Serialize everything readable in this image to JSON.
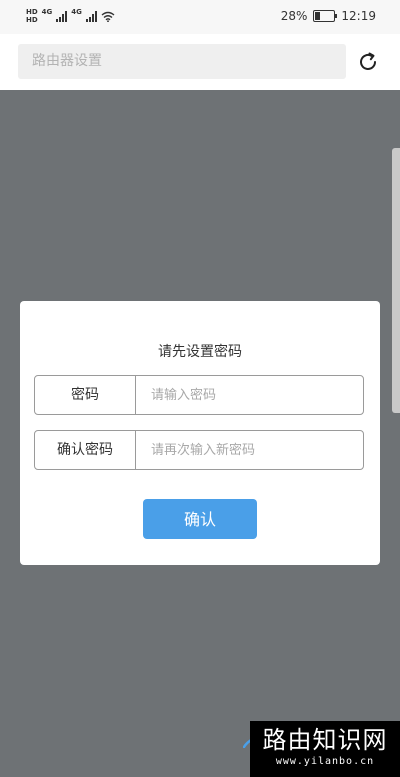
{
  "status_bar": {
    "left_labels": [
      "HD",
      "4G",
      "4G",
      "HD"
    ],
    "battery": "28%",
    "battery_level": 0.28,
    "time": "12:19",
    "icons": [
      "hd-icon",
      "signal-icon",
      "wifi-icon",
      "battery-icon"
    ]
  },
  "topbar": {
    "address_placeholder": "路由器设置",
    "reload_icon": "reload-icon"
  },
  "dialog": {
    "title": "请先设置密码",
    "fields": [
      {
        "label": "密码",
        "placeholder": "请输入密码",
        "value": ""
      },
      {
        "label": "确认密码",
        "placeholder": "请再次输入新密码",
        "value": ""
      }
    ],
    "confirm_label": "确认"
  },
  "watermark": {
    "title": "路由知识网",
    "url": "www.yilanbo.cn"
  },
  "colors": {
    "overlay": "#6e7275",
    "button": "#4a9fe8",
    "address_bg": "#efefef"
  }
}
